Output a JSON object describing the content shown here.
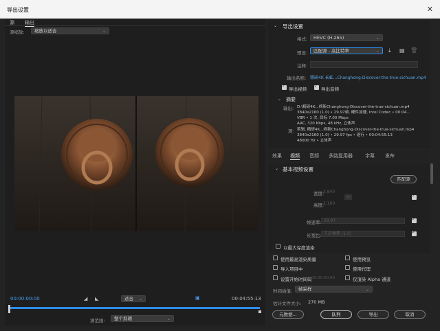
{
  "window": {
    "title": "导出设置",
    "close": "✕"
  },
  "left": {
    "tabs": [
      "源",
      "输出"
    ],
    "scale_label": "源缩放:",
    "scale_value": "缩放以适合",
    "timecode_start": "00:00:00:00",
    "fit_value": "适合",
    "timecode_end": "00:04:55:13",
    "range_label": "源范围:",
    "range_value": "整个剪辑"
  },
  "export_settings": {
    "header": "导出设置",
    "format_label": "格式:",
    "format_value": "HEVC (H.265)",
    "preset_label": "预设:",
    "preset_value": "匹配源 - 高比特率",
    "comment_label": "注释:",
    "output_name_label": "输出名称:",
    "output_name_value": "精研4K 长虹...Changhong-Discover-the-true-sichuan.mp4",
    "export_video_label": "导出视频",
    "export_audio_label": "导出音频",
    "summary_header": "摘要",
    "output_label": "输出:",
    "output_lines": [
      "D:\\精研4K...终新Changhong-Discover-the-true-sichuan.mp4",
      "3840x2160 (1.0) • 29.97帧, 硬件加速, Intel Codec •  00:04...",
      "VBR • 1 次, 目标 7.00 Mbps",
      "AAC, 320 Kbps, 48 kHz, 立体声"
    ],
    "source_label": "源:",
    "source_lines": [
      "剪辑, 精研4K...终新Changhong-Discover-the-true-sichuan.mp4",
      "3840x2160 (1.0) • 29.97 fps • 逐行 • 00:04:55:13",
      "48000 Hz • 立体声"
    ]
  },
  "subtabs": [
    "效果",
    "视频",
    "音频",
    "多路复用器",
    "字幕",
    "发布"
  ],
  "video_settings": {
    "header": "基本视频设置",
    "match_source_button": "匹配源",
    "width_label": "宽度:",
    "width_value": "3,840",
    "height_label": "高度:",
    "height_value": "2,160",
    "frame_rate_label": "帧速率:",
    "frame_rate_value": "29.97",
    "aspect_label": "长宽比:",
    "aspect_value": "方形像素 (1.0)",
    "max_depth_label": "以最大深度渲染"
  },
  "options": {
    "max_render_quality": "使用最高渲染质量",
    "use_previews": "使用预览",
    "import_into_project": "导入项目中",
    "use_proxies": "使用代理",
    "set_start_timecode": "设置开始时间码",
    "start_timecode_value": "00:00:00:00",
    "render_alpha_only": "仅渲染 Alpha 通道",
    "time_interp_label": "时间插值:",
    "time_interp_value": "帧采样",
    "file_size_label": "估计文件大小:",
    "file_size_value": "270 MB"
  },
  "buttons": {
    "metadata": "元数据...",
    "queue": "队列",
    "export": "导出",
    "cancel": "取消"
  },
  "colors": {
    "accent": "#2d8ceb",
    "link": "#5aa8e8"
  }
}
